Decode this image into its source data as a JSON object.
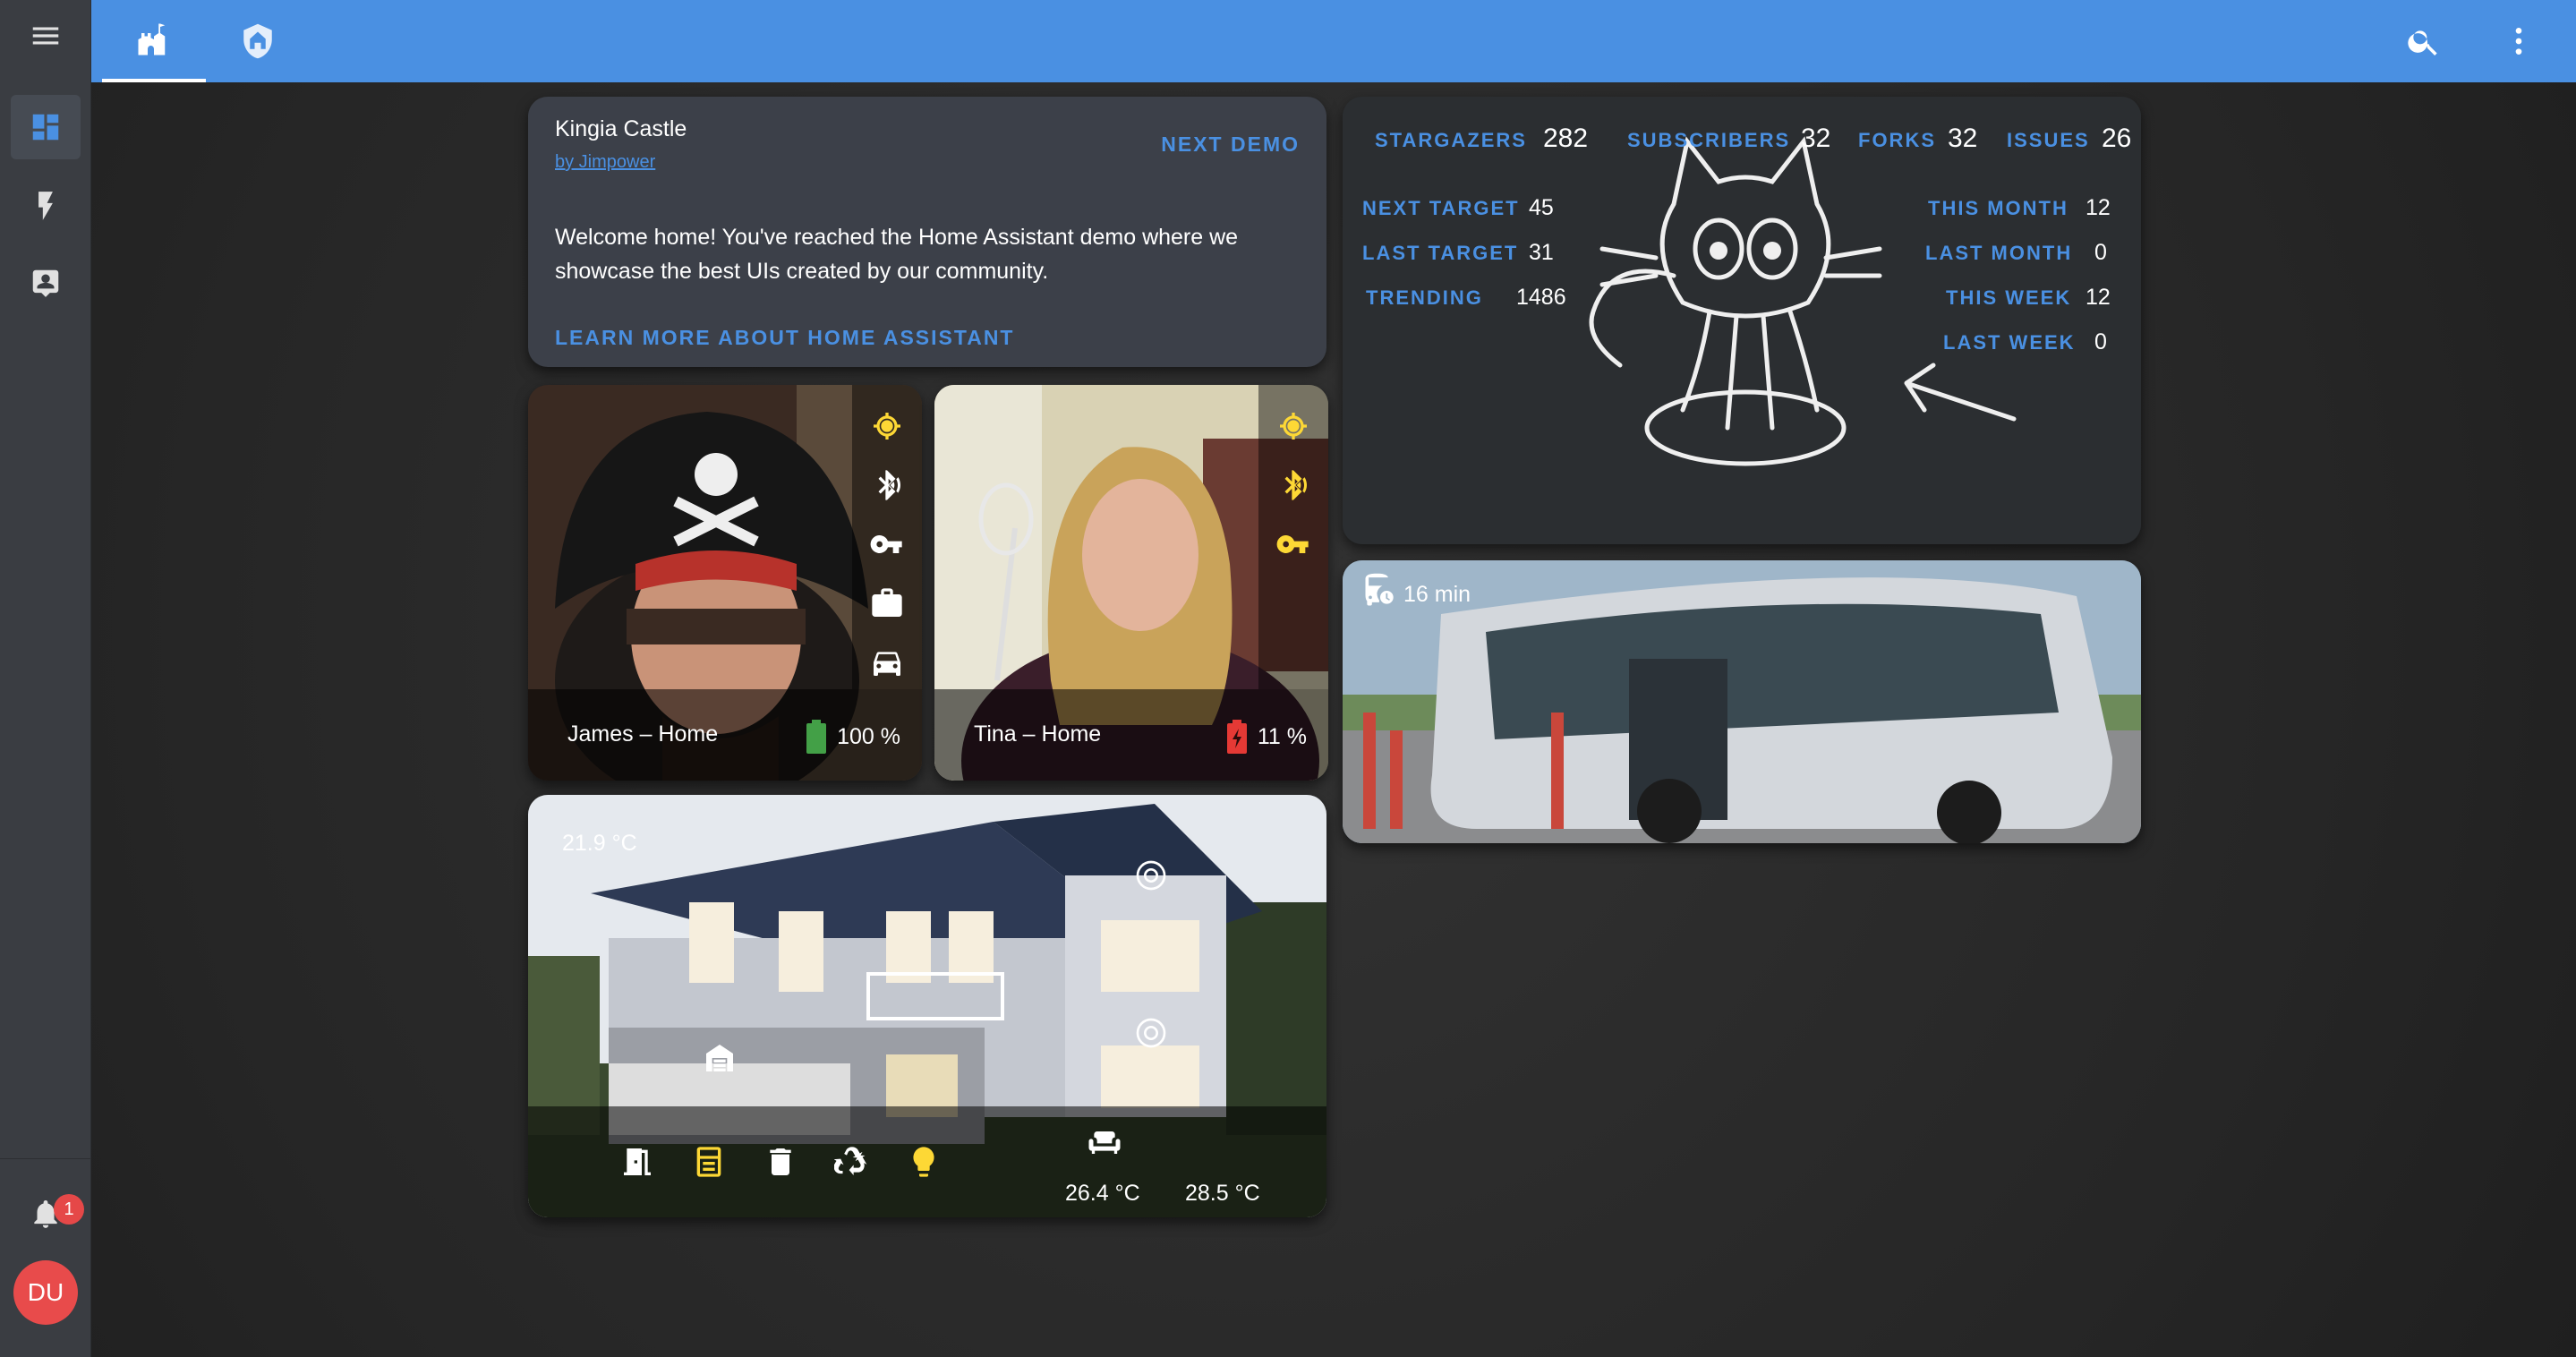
{
  "sidebar": {
    "items": [
      {
        "icon": "menu-icon"
      },
      {
        "icon": "dashboard-icon",
        "active": true
      },
      {
        "icon": "flash-icon"
      },
      {
        "icon": "account-box-icon"
      }
    ],
    "notifications_count": "1",
    "user_initials": "DU"
  },
  "header": {
    "tabs": [
      {
        "icon": "castle-icon",
        "active": true
      },
      {
        "icon": "home-shield-icon",
        "active": false
      }
    ],
    "actions": [
      "search-icon",
      "dots-vertical-icon"
    ]
  },
  "intro_card": {
    "title": "Kingia Castle",
    "author": "by Jimpower",
    "next_demo": "NEXT DEMO",
    "welcome": "Welcome home! You've reached the Home Assistant demo where we showcase the best UIs created by our community.",
    "learn_more": "LEARN MORE ABOUT HOME ASSISTANT"
  },
  "people": [
    {
      "name": "James – Home",
      "battery": "100 %",
      "battery_color": "#43a047",
      "icons": [
        "crosshairs-gps-icon",
        "bluetooth-audio-icon",
        "key-icon",
        "briefcase-icon",
        "car-icon"
      ]
    },
    {
      "name": "Tina – Home",
      "battery": "11 %",
      "battery_color": "#e53935",
      "icons": [
        "crosshairs-gps-icon",
        "bluetooth-audio-icon",
        "key-icon"
      ]
    }
  ],
  "house": {
    "temperature": "21.9 °C",
    "icons": [
      "door-icon",
      "washing-machine-icon",
      "trash-icon",
      "recycle-icon",
      "lightbulb-icon",
      "sofa-icon"
    ],
    "temp_living": "26.4 °C",
    "temp_other": "28.5 °C"
  },
  "github": {
    "stargazers_label": "STARGAZERS",
    "stargazers": "282",
    "subscribers_label": "SUBSCRIBERS",
    "subscribers": "32",
    "forks_label": "FORKS",
    "forks": "32",
    "issues_label": "ISSUES",
    "issues": "26",
    "next_target_label": "NEXT TARGET",
    "next_target": "45",
    "last_target_label": "LAST TARGET",
    "last_target": "31",
    "trending_label": "TRENDING",
    "trending": "1486",
    "this_month_label": "THIS MONTH",
    "this_month": "12",
    "last_month_label": "LAST MONTH",
    "last_month": "0",
    "this_week_label": "THIS WEEK",
    "this_week": "12",
    "last_week_label": "LAST WEEK",
    "last_week": "0"
  },
  "bus": {
    "time": "16 min"
  },
  "colors": {
    "accent": "#4a90e2",
    "active_yellow": "#fdd835",
    "badge": "#e54848"
  }
}
